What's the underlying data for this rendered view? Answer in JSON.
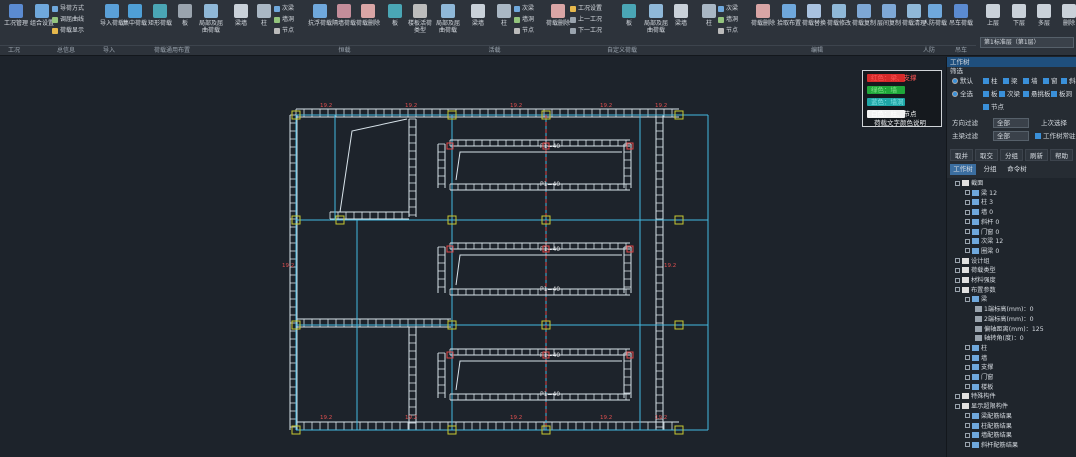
{
  "ribbon": {
    "tools": [
      {
        "label": "工况管理",
        "icon": "case-manage-icon"
      },
      {
        "label": "组合设置",
        "icon": "combo-settings-icon"
      },
      {
        "label": "导入荷载",
        "icon": "import-load-icon"
      },
      {
        "label": "集中荷载",
        "icon": "point-load-icon"
      },
      {
        "label": "矩形荷载",
        "icon": "rect-load-icon"
      },
      {
        "label": "板",
        "icon": "slab-icon"
      },
      {
        "label": "局部及屈曲荷载",
        "icon": "local-load-icon"
      },
      {
        "label": "梁墙",
        "icon": "beam-wall-icon"
      },
      {
        "label": "柱",
        "icon": "column-icon"
      },
      {
        "label": "抗浮荷载",
        "icon": "uplift-load-icon"
      },
      {
        "label": "隔墙荷载",
        "icon": "partition-load-icon"
      },
      {
        "label": "荷载删除",
        "icon": "delete-load-icon"
      },
      {
        "label": "板",
        "icon": "slab2-icon"
      },
      {
        "label": "楼板活荷类型",
        "icon": "live-load-type-icon"
      },
      {
        "label": "局部及屈曲荷载",
        "icon": "local-load2-icon"
      },
      {
        "label": "梁墙",
        "icon": "beam-wall2-icon"
      },
      {
        "label": "柱",
        "icon": "column2-icon"
      },
      {
        "label": "荷载删除",
        "icon": "delete-load2-icon"
      },
      {
        "label": "板",
        "icon": "slab3-icon"
      },
      {
        "label": "局部及屈曲荷载",
        "icon": "local-load3-icon"
      },
      {
        "label": "梁墙",
        "icon": "beam-wall3-icon"
      },
      {
        "label": "柱",
        "icon": "column3-icon"
      },
      {
        "label": "荷载删除",
        "icon": "delete-load3-icon"
      },
      {
        "label": "拾取布置",
        "icon": "pick-place-icon"
      },
      {
        "label": "荷载替换",
        "icon": "load-replace-icon"
      },
      {
        "label": "荷载修改",
        "icon": "load-modify-icon"
      },
      {
        "label": "荷载复制",
        "icon": "load-copy-icon"
      },
      {
        "label": "层间复制",
        "icon": "floor-copy-icon"
      },
      {
        "label": "荷载清理",
        "icon": "load-clean-icon"
      },
      {
        "label": "人防荷载",
        "icon": "civil-defense-icon"
      },
      {
        "label": "吊车荷载",
        "icon": "crane-load-icon"
      },
      {
        "label": "上层",
        "icon": "up-floor-icon"
      },
      {
        "label": "下层",
        "icon": "down-floor-icon"
      },
      {
        "label": "多层",
        "icon": "multi-floor-icon"
      },
      {
        "label": "删除",
        "icon": "delete-icon"
      }
    ],
    "stack1": [
      "导荷方式",
      "调屈曲线",
      "荷载显示"
    ],
    "stack2": [
      "次梁",
      "墙洞",
      "节点"
    ],
    "stack3": [
      "次梁",
      "墙洞",
      "节点"
    ],
    "stack4": [
      "工况设置",
      "上一工况",
      "下一工况"
    ],
    "stack5": [
      "次梁",
      "墙洞",
      "节点"
    ],
    "groups": [
      "工况",
      "总信息",
      "导入",
      "荷载通用布置",
      "恒载",
      "活载",
      "自定义荷载",
      "编辑",
      "人防",
      "吊车"
    ],
    "floor_select": "第1标准层（第1层）"
  },
  "legend": {
    "items": [
      {
        "text": "红色：梁、支撑",
        "color": "#d62a2a"
      },
      {
        "text": "绿色：墙",
        "color": "#1fa83a"
      },
      {
        "text": "蓝色：墙洞",
        "color": "#1ea6a6"
      },
      {
        "text": "白色：柱、节点",
        "color": "#f2f2f2"
      }
    ],
    "caption": "荷载文字颜色说明"
  },
  "plan": {
    "load_labels": [
      "P1=40",
      "P1=40",
      "P1=40",
      "P1=40",
      "P1=40",
      "P1=40"
    ],
    "dim_labels": [
      "19.2",
      "19.2",
      "19.2",
      "19.2",
      "19.2",
      "19.2",
      "19.2",
      "19.2",
      "19.2",
      "19.2",
      "19.2",
      "19.2"
    ]
  },
  "panel": {
    "title": "工作树",
    "filter_label": "筛选",
    "radio_default": "默认",
    "radio_all": "全选",
    "checks_row1": [
      "柱",
      "梁",
      "墙",
      "窗",
      "斜杆"
    ],
    "checks_row2": [
      "板",
      "次梁",
      "悬挑板",
      "板洞"
    ],
    "checks_row3": [
      "节点"
    ],
    "dir_filter_label": "方向过滤",
    "dir_filter_value": "全部",
    "last_select": "上次选择",
    "main_filter_label": "主梁过滤",
    "main_filter_value": "全部",
    "work_tree_check": "工作树常驻",
    "buttons": [
      "取并",
      "取交",
      "分组",
      "刷新",
      "帮助"
    ],
    "tabs": [
      "工作树",
      "分组",
      "命令树"
    ],
    "tree": [
      {
        "text": "截面",
        "level": 1,
        "color": "#e0e0e0"
      },
      {
        "text": "梁 12",
        "level": 2,
        "color": "#e0e0e0"
      },
      {
        "text": "柱 3",
        "level": 2,
        "color": "#e0e0e0"
      },
      {
        "text": "墙 0",
        "level": 2,
        "color": "#e0e0e0"
      },
      {
        "text": "斜杆 0",
        "level": 2,
        "color": "#e0e0e0"
      },
      {
        "text": "门窗 0",
        "level": 2,
        "color": "#e0e0e0"
      },
      {
        "text": "次梁 12",
        "level": 2,
        "color": "#e0e0e0"
      },
      {
        "text": "圈梁 0",
        "level": 2,
        "color": "#e0e0e0"
      },
      {
        "text": "设计组",
        "level": 1,
        "color": "#e0e0e0"
      },
      {
        "text": "荷载类型",
        "level": 1,
        "color": "#e0e0e0"
      },
      {
        "text": "材料强度",
        "level": 1,
        "color": "#e0e0e0"
      },
      {
        "text": "布置参数",
        "level": 1,
        "color": "#e0e0e0"
      },
      {
        "text": "梁",
        "level": 2,
        "color": "#e0e0e0"
      },
      {
        "text": "1端标高(mm)：0",
        "level": 3,
        "color": "#e0e0e0"
      },
      {
        "text": "2端标高(mm)：0",
        "level": 3,
        "color": "#e0e0e0"
      },
      {
        "text": "偏轴距离(mm)：125",
        "level": 3,
        "color": "#e0e0e0"
      },
      {
        "text": "轴转角(度)：0",
        "level": 3,
        "color": "#e0e0e0"
      },
      {
        "text": "柱",
        "level": 2,
        "color": "#e0e0e0"
      },
      {
        "text": "墙",
        "level": 2,
        "color": "#e0e0e0"
      },
      {
        "text": "支撑",
        "level": 2,
        "color": "#e0e0e0"
      },
      {
        "text": "门窗",
        "level": 2,
        "color": "#e0e0e0"
      },
      {
        "text": "楼板",
        "level": 2,
        "color": "#e0e0e0"
      },
      {
        "text": "特殊构件",
        "level": 1,
        "color": "#e0e0e0"
      },
      {
        "text": "显示超限构件",
        "level": 1,
        "color": "#e0e0e0"
      },
      {
        "text": "梁配筋结果",
        "level": 2,
        "color": "#e0e0e0"
      },
      {
        "text": "柱配筋结果",
        "level": 2,
        "color": "#e0e0e0"
      },
      {
        "text": "墙配筋结果",
        "level": 2,
        "color": "#e0e0e0"
      },
      {
        "text": "斜杆配筋结果",
        "level": 2,
        "color": "#e0e0e0"
      }
    ]
  }
}
